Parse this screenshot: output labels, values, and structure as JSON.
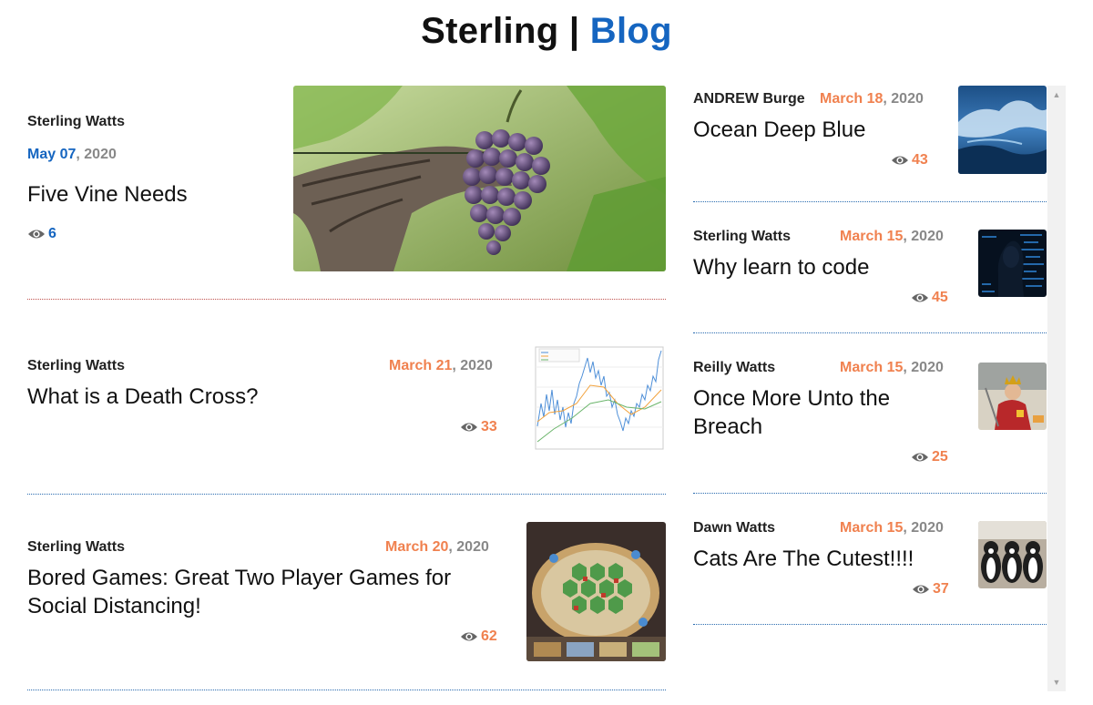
{
  "site": {
    "brand": "Sterling",
    "separator": "|",
    "section": "Blog"
  },
  "colors": {
    "accent_blue": "#1565c0",
    "accent_orange": "#f0814f",
    "date_grey": "#888888"
  },
  "featured": {
    "author": "Sterling Watts",
    "date_md": "May 07",
    "date_year": ", 2020",
    "title": "Five Vine Needs",
    "views": "6",
    "image": "grapes-on-vine-photo"
  },
  "left_posts": [
    {
      "author": "Sterling Watts",
      "date_md": "March 21",
      "date_year": ", 2020",
      "title": "What is a Death Cross?",
      "views": "33",
      "image": "stock-price-chart-thumbnail"
    },
    {
      "author": "Sterling Watts",
      "date_md": "March 20",
      "date_year": ", 2020",
      "title": "Bored Games: Great Two Player Games for Social Distancing!",
      "views": "62",
      "image": "board-game-photo"
    }
  ],
  "right_posts": [
    {
      "author": "ANDREW Burge",
      "date_md": "March 18",
      "date_year": ", 2020",
      "title": "Ocean Deep Blue",
      "views": "43",
      "image": "ocean-wave-photo"
    },
    {
      "author": "Sterling Watts",
      "date_md": "March 15",
      "date_year": ", 2020",
      "title": "Why learn to code",
      "views": "45",
      "image": "hacker-code-photo"
    },
    {
      "author": "Reilly Watts",
      "date_md": "March 15",
      "date_year": ", 2020",
      "title": "Once More Unto the Breach",
      "views": "25",
      "image": "king-costume-photo"
    },
    {
      "author": "Dawn Watts",
      "date_md": "March 15",
      "date_year": ", 2020",
      "title": "Cats Are The Cutest!!!!",
      "views": "37",
      "image": "cats-photo"
    }
  ],
  "icons": {
    "views": "eye-icon",
    "scroll_up": "scroll-up-arrow",
    "scroll_down": "scroll-down-arrow"
  }
}
